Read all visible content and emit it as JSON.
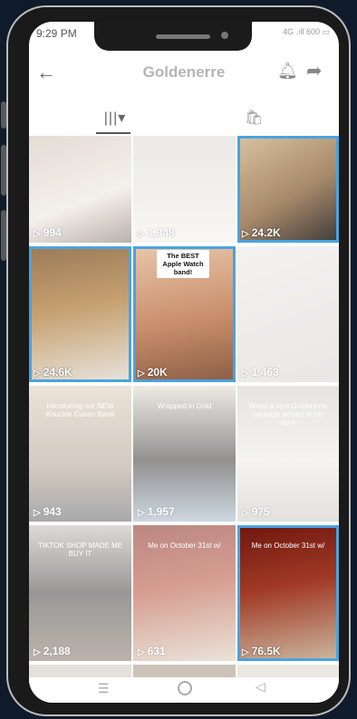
{
  "status_bar": {
    "time": "9:29 PM",
    "right_indicators": "4G .ıll 600 ▭"
  },
  "header": {
    "title": "Goldenerre"
  },
  "grid": {
    "items": [
      {
        "count": "994",
        "selected": false,
        "caption": ""
      },
      {
        "count": "1,348",
        "selected": false,
        "caption": ""
      },
      {
        "count": "24.2K",
        "selected": true,
        "caption": ""
      },
      {
        "count": "24.6K",
        "selected": true,
        "caption": ""
      },
      {
        "count": "20K",
        "selected": true,
        "caption": "The BEST Apple Watch band!"
      },
      {
        "count": "1,463",
        "selected": false,
        "caption": ""
      },
      {
        "count": "943",
        "selected": false,
        "caption": "Introducing our NEW Knuckle Cuban Band"
      },
      {
        "count": "1,957",
        "selected": false,
        "caption": "Wrapped in Gold"
      },
      {
        "count": "975",
        "selected": false,
        "caption": "When a new Goldenerre package arrives at my door"
      },
      {
        "count": "2,188",
        "selected": false,
        "caption": "TIKTOK SHOP MADE ME BUY IT"
      },
      {
        "count": "631",
        "selected": false,
        "caption": "Me on October 31st w/"
      },
      {
        "count": "76.5K",
        "selected": true,
        "caption": "Me on October 31st w/"
      }
    ]
  }
}
